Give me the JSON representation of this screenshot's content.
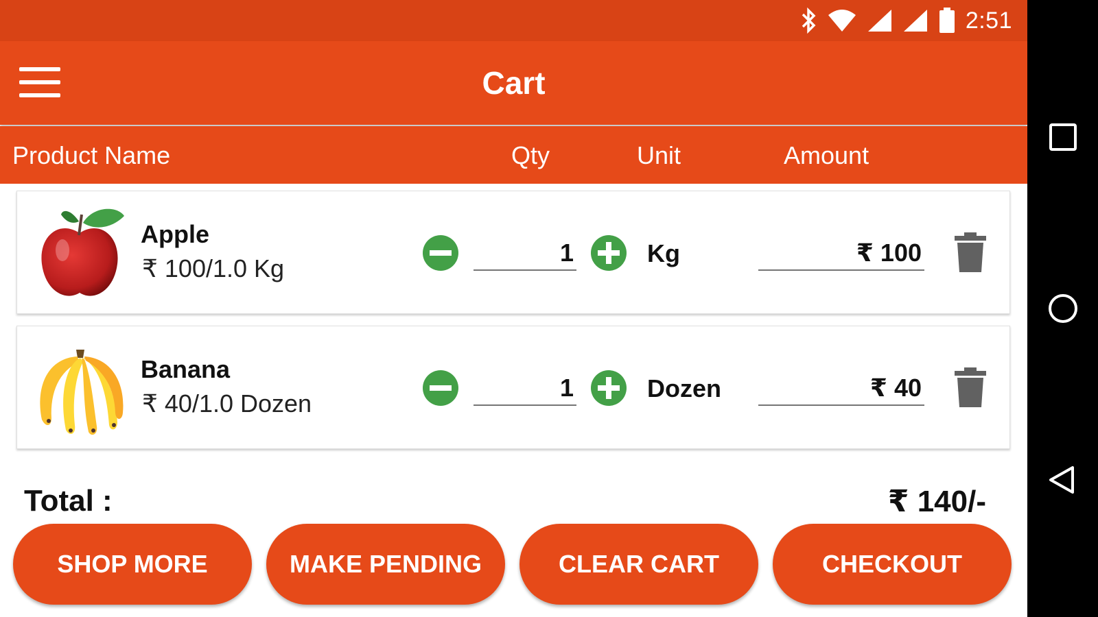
{
  "status_bar": {
    "time": "2:51",
    "icons": [
      "bluetooth-icon",
      "wifi-icon",
      "signal-icon",
      "signal-icon",
      "battery-icon"
    ]
  },
  "app_bar": {
    "title": "Cart",
    "menu_icon": "hamburger-menu-icon"
  },
  "table_header": {
    "product_name": "Product Name",
    "qty": "Qty",
    "unit": "Unit",
    "amount": "Amount"
  },
  "items": [
    {
      "name": "Apple",
      "price": "₹ 100/1.0 Kg",
      "qty": "1",
      "unit": "Kg",
      "amount": "₹ 100",
      "image": "apple-image"
    },
    {
      "name": "Banana",
      "price": "₹ 40/1.0 Dozen",
      "qty": "1",
      "unit": "Dozen",
      "amount": "₹ 40",
      "image": "banana-image"
    }
  ],
  "total": {
    "label": "Total :",
    "value": "₹ 140/-"
  },
  "buttons": {
    "shop_more": "SHOP MORE",
    "make_pending": "MAKE PENDING",
    "clear_cart": "CLEAR CART",
    "checkout": "CHECKOUT"
  },
  "colors": {
    "primary": "#e64a19",
    "primary_dark": "#d84315",
    "accent_green": "#43a047",
    "delete_gray": "#616161"
  }
}
